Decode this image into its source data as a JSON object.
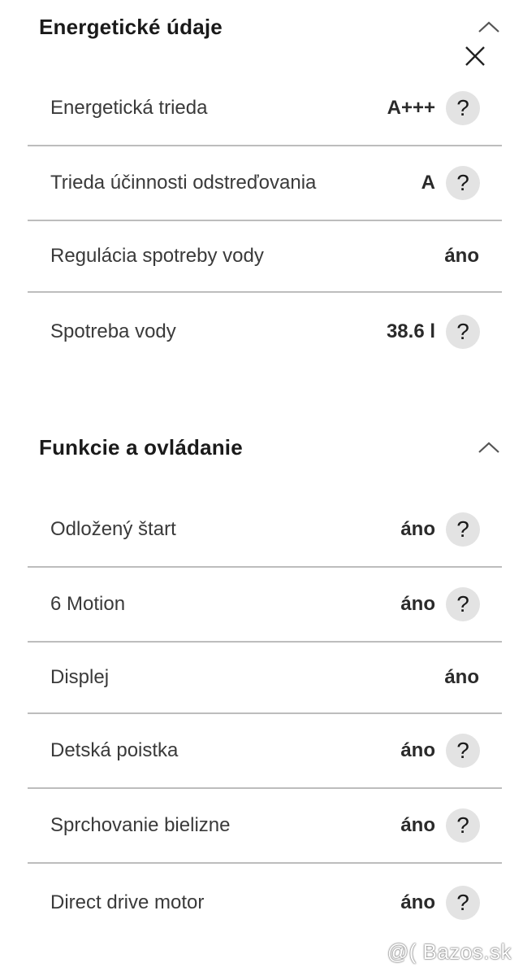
{
  "sections": [
    {
      "title": "Energetické údaje",
      "rows": [
        {
          "label": "Energetická trieda",
          "value": "A+++",
          "help": "?"
        },
        {
          "label": "Trieda účinnosti odstreďovania",
          "value": "A",
          "help": "?"
        },
        {
          "label": "Regulácia spotreby vody",
          "value": "áno",
          "help": null
        },
        {
          "label": "Spotreba vody",
          "value": "38.6 l",
          "help": "?"
        }
      ]
    },
    {
      "title": "Funkcie a ovládanie",
      "rows": [
        {
          "label": "Odložený štart",
          "value": "áno",
          "help": "?"
        },
        {
          "label": "6 Motion",
          "value": "áno",
          "help": "?"
        },
        {
          "label": "Displej",
          "value": "áno",
          "help": null
        },
        {
          "label": "Detská poistka",
          "value": "áno",
          "help": "?"
        },
        {
          "label": "Sprchovanie bielizne",
          "value": "áno",
          "help": "?"
        },
        {
          "label": "Direct drive motor",
          "value": "áno",
          "help": "?"
        }
      ]
    }
  ],
  "icons": {
    "collapse": "chevron-up-icon",
    "close": "close-icon",
    "help": "question-mark-icon"
  },
  "watermark": "@( Bazos.sk"
}
